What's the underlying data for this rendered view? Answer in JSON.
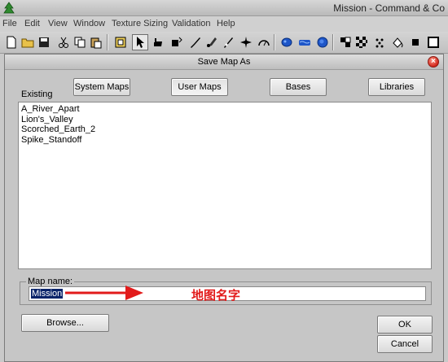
{
  "app": {
    "title": "Mission - Command & Co",
    "logo_icon": "green-tree-logo-icon"
  },
  "menu": [
    {
      "label": "File"
    },
    {
      "label": "Edit"
    },
    {
      "label": "View"
    },
    {
      "label": "Window"
    },
    {
      "label": "Texture Sizing"
    },
    {
      "label": "Validation"
    },
    {
      "label": "Help"
    }
  ],
  "toolbar": {
    "icons": [
      "new-file-icon",
      "open-folder-icon",
      "save-icon",
      "cut-icon",
      "copy-icon",
      "paste-icon",
      "fit-view-icon",
      "pointer-icon",
      "hand-icon",
      "move-icon",
      "brush-icon",
      "paint-brush-icon",
      "stamp-icon",
      "burst-icon",
      "gauge-icon",
      "blob-icon",
      "water-icon",
      "cloud-icon",
      "tile-icon",
      "checker-icon",
      "dots-icon",
      "fill-icon",
      "square-solid-icon",
      "square-outline-icon"
    ]
  },
  "dialog": {
    "title": "Save Map As",
    "existing_label": "Existing",
    "tabs": [
      {
        "label": "System Maps"
      },
      {
        "label": "User Maps"
      },
      {
        "label": "Bases"
      },
      {
        "label": "Libraries"
      }
    ],
    "active_tab": "User Maps",
    "maps": [
      "A_River_Apart",
      "Lion's_Valley",
      "Scorched_Earth_2",
      "Spike_Standoff"
    ],
    "map_name_label": "Map name:",
    "map_name_value": "Mission",
    "browse_label": "Browse...",
    "ok_label": "OK",
    "cancel_label": "Cancel"
  },
  "annotation": {
    "text": "地图名字",
    "color": "#e21b1b"
  }
}
